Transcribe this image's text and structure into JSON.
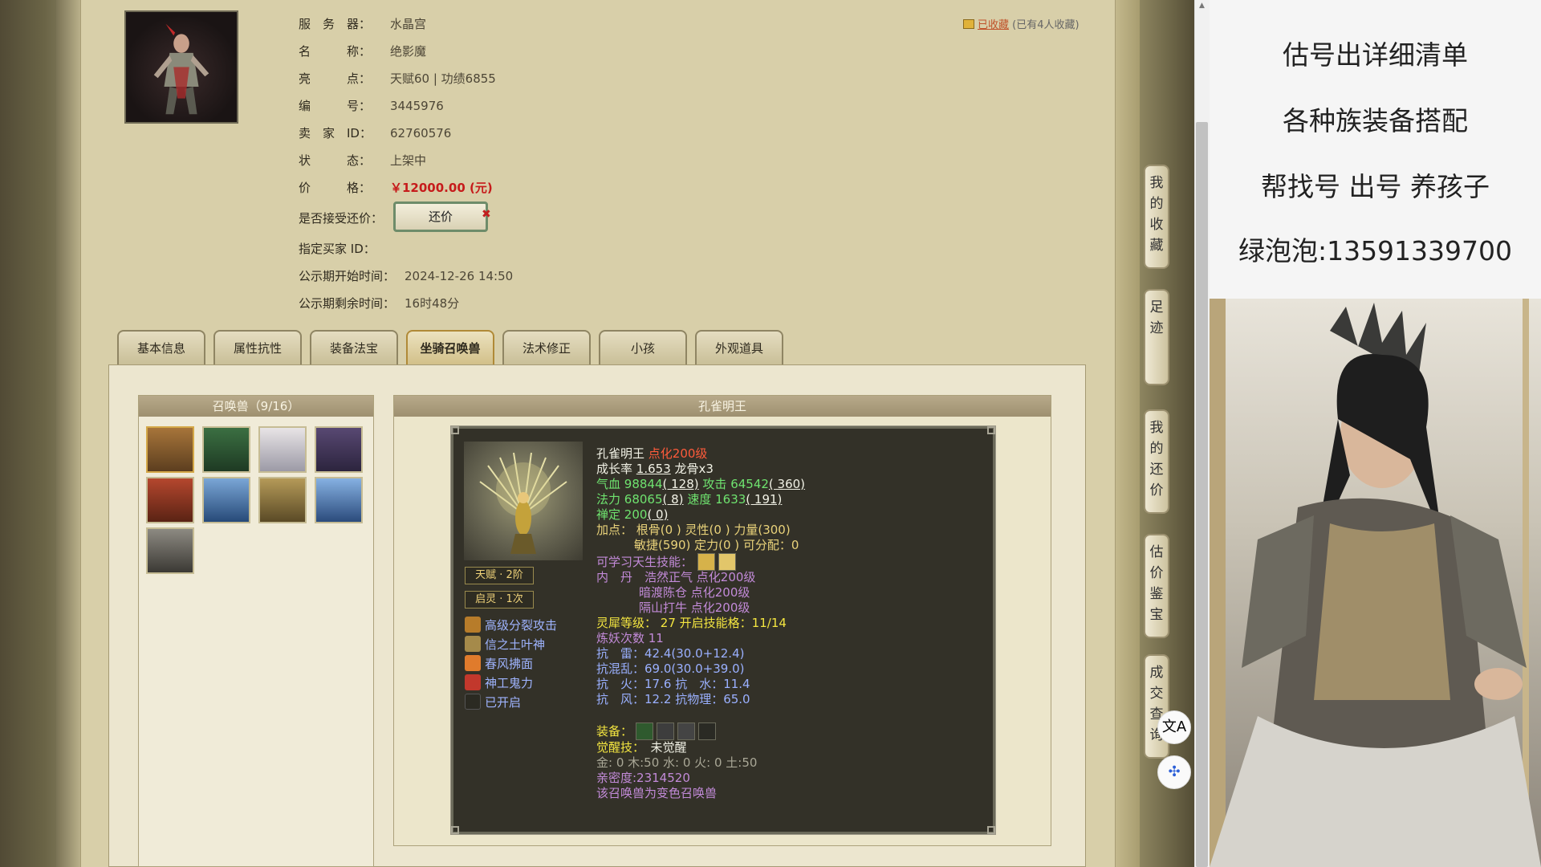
{
  "seller_info": {
    "server_label": "服　务　器：",
    "server_value": "水晶宫",
    "name_label": "名　　　称：",
    "name_value": "绝影魔",
    "highlight_label": "亮　　　点：",
    "highlight_value": "天赋60 | 功绩6855",
    "id_label": "编　　　号：",
    "id_value": "3445976",
    "seller_label": "卖　家　ID：",
    "seller_value": "62760576",
    "status_label": "状　　　态：",
    "status_value": "上架中",
    "price_label": "价　　　格：",
    "price_value": "￥12000.00 (元)",
    "counter_label": "是否接受还价：",
    "counter_button": "还价",
    "counter_x": "✖",
    "buyer_label": "指定买家 ID：",
    "buyer_value": "",
    "start_label": "公示期开始时间：",
    "start_value": "2024-12-26 14:50",
    "remain_label": "公示期剩余时间：",
    "remain_value": "16时48分"
  },
  "collect": {
    "link": "已收藏",
    "count": "(已有4人收藏)"
  },
  "tabs": [
    "基本信息",
    "属性抗性",
    "装备法宝",
    "坐骑召唤兽",
    "法术修正",
    "小孩",
    "外观道具"
  ],
  "active_tab": 3,
  "pet_list": {
    "header": "召唤兽（9/16）",
    "count": 9
  },
  "pet_detail": {
    "header": "孔雀明王",
    "name": "孔雀明王",
    "level": "点化200级",
    "growth_label": "成长率",
    "growth": "1.653",
    "dragon_bone": "龙骨x3",
    "hp_label": "气血",
    "hp": "98844",
    "hp_add": "( 128)",
    "atk_label": "攻击",
    "atk": "64542",
    "atk_add": "( 360)",
    "mp_label": "法力",
    "mp": "68065",
    "mp_add": "( 8)",
    "spd_label": "速度",
    "spd": "1633",
    "spd_add": "( 191)",
    "zen_label": "禅定",
    "zen": "200",
    "zen_add": "( 0)",
    "points_line1": "加点：  根骨(0 ) 灵性(0 ) 力量(300)",
    "points_line2": "敏捷(590) 定力(0 ) 可分配：0",
    "learnable_label": "可学习天生技能：",
    "neidan_label": "内　丹",
    "neidan1": "浩然正气 点化200级",
    "neidan2": "暗渡陈仓 点化200级",
    "neidan3": "隔山打牛 点化200级",
    "spirit_label": "灵犀等级：",
    "spirit": "27",
    "spirit_skill": "开启技能格：11/14",
    "refine": "炼妖次数 11",
    "res_thunder": "抗　雷：42.4(30.0+12.4)",
    "res_chaos": "抗混乱：69.0(30.0+39.0)",
    "res_fire": "抗　火：17.6",
    "res_water": "抗　水：11.4",
    "res_wind": "抗　风：12.2",
    "res_phys": "抗物理：65.0",
    "equip_label": "装备：",
    "awaken_label": "觉醒技：",
    "awaken_value": "未觉醒",
    "elements": "金: 0 木:50 水: 0 火: 0 土:50",
    "intimacy": "亲密度:2314520",
    "variant": "该召唤兽为变色召唤兽",
    "talent_badge": "天赋 · 2阶",
    "spirit_badge": "启灵 · 1次",
    "skills": [
      "高级分裂攻击",
      "信之土叶神",
      "春风拂面",
      "神工鬼力",
      "已开启"
    ]
  },
  "right_nav": [
    "我的收藏",
    "足迹",
    "我的还价",
    "估价鉴宝",
    "成交查询"
  ],
  "float_buttons": [
    "文A",
    "✣"
  ],
  "ad_text": [
    "估号出详细清单",
    "各种族装备搭配",
    "帮找号 出号 养孩子",
    "绿泡泡:13591339700"
  ],
  "colors": {
    "price": "#c61b1b",
    "level": "#ff5b3b",
    "green_stat": "#6fe36f",
    "yellow_stat": "#f4e640",
    "skill": "#9fb4ff"
  }
}
